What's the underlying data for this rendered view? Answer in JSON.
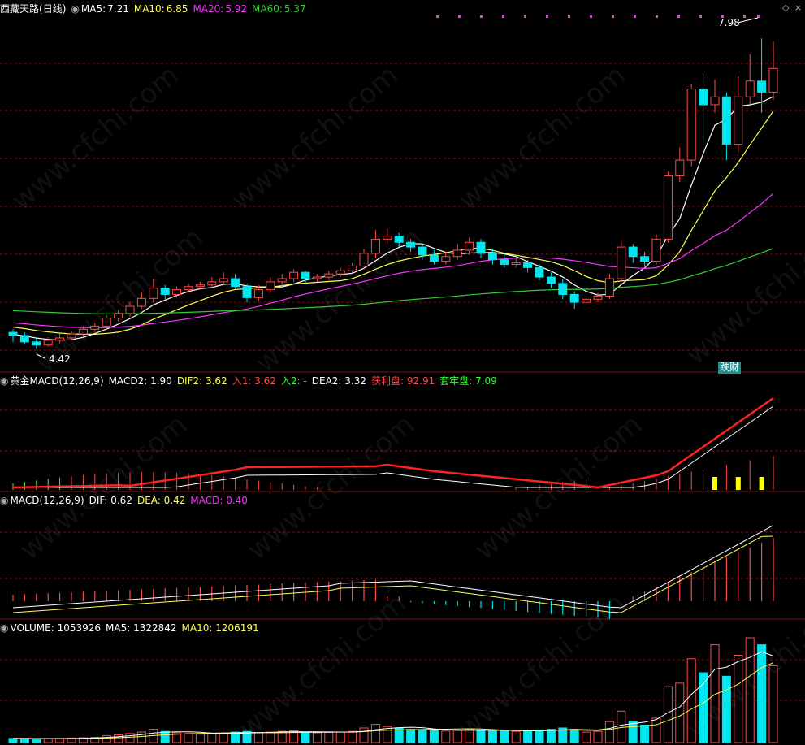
{
  "app": {
    "title": "西藏天路",
    "period": "(日线)"
  },
  "colors": {
    "bg": "#000000",
    "grid": "#7a1212",
    "up": "#ff4a4a",
    "down": "#00e5ee",
    "ma5": "#ffffff",
    "ma10": "#ffff55",
    "ma20": "#ff33ff",
    "ma60": "#33cc33"
  },
  "main": {
    "ma5": {
      "label": "MA5:",
      "value": "7.21"
    },
    "ma10": {
      "label": "MA10:",
      "value": "6.85"
    },
    "ma20": {
      "label": "MA20:",
      "value": "5.92"
    },
    "ma60": {
      "label": "MA60:",
      "value": "5.37"
    },
    "high_label": "7.98",
    "low_label": "4.42",
    "tag": "跌财"
  },
  "gold": {
    "name": "黄金MACD(12,26,9)",
    "macd2": "MACD2: 1.90",
    "dif2": "DIF2: 3.62",
    "in1": "入1: 3.62",
    "in2": "入2: -",
    "dea2": "DEA2: 3.32",
    "profit": "获利盘: 92.91",
    "trapped": "套牢盘: 7.09"
  },
  "macd": {
    "name": "MACD(12,26,9)",
    "dif": "DIF: 0.62",
    "dea": "DEA: 0.42",
    "macd": "MACD: 0.40"
  },
  "volume": {
    "name": "VOLUME: 1053926",
    "ma5": "MA5: 1322842",
    "ma10": "MA10: 1206191"
  },
  "watermark": "www.cfchi.com",
  "chart_data": {
    "type": "candlestick",
    "candles": [
      [
        4.62,
        4.58,
        4.66,
        4.5
      ],
      [
        4.58,
        4.5,
        4.62,
        4.47
      ],
      [
        4.5,
        4.46,
        4.55,
        4.42
      ],
      [
        4.46,
        4.52,
        4.56,
        4.44
      ],
      [
        4.52,
        4.55,
        4.6,
        4.48
      ],
      [
        4.55,
        4.6,
        4.64,
        4.52
      ],
      [
        4.6,
        4.66,
        4.7,
        4.57
      ],
      [
        4.66,
        4.7,
        4.74,
        4.62
      ],
      [
        4.7,
        4.8,
        4.84,
        4.66
      ],
      [
        4.8,
        4.86,
        4.9,
        4.76
      ],
      [
        4.86,
        4.95,
        5.0,
        4.82
      ],
      [
        4.95,
        5.05,
        5.12,
        4.92
      ],
      [
        5.05,
        5.18,
        5.3,
        5.0
      ],
      [
        5.18,
        5.1,
        5.22,
        5.04
      ],
      [
        5.1,
        5.16,
        5.2,
        5.06
      ],
      [
        5.16,
        5.2,
        5.24,
        5.12
      ],
      [
        5.2,
        5.22,
        5.26,
        5.16
      ],
      [
        5.22,
        5.26,
        5.32,
        5.18
      ],
      [
        5.26,
        5.3,
        5.38,
        5.22
      ],
      [
        5.3,
        5.2,
        5.36,
        5.16
      ],
      [
        5.2,
        5.06,
        5.24,
        5.0
      ],
      [
        5.06,
        5.16,
        5.22,
        5.02
      ],
      [
        5.16,
        5.26,
        5.32,
        5.12
      ],
      [
        5.26,
        5.3,
        5.36,
        5.2
      ],
      [
        5.3,
        5.38,
        5.42,
        5.26
      ],
      [
        5.38,
        5.3,
        5.4,
        5.24
      ],
      [
        5.3,
        5.32,
        5.36,
        5.26
      ],
      [
        5.32,
        5.36,
        5.4,
        5.28
      ],
      [
        5.36,
        5.4,
        5.44,
        5.32
      ],
      [
        5.4,
        5.46,
        5.5,
        5.36
      ],
      [
        5.46,
        5.62,
        5.68,
        5.42
      ],
      [
        5.62,
        5.8,
        5.92,
        5.56
      ],
      [
        5.8,
        5.84,
        5.94,
        5.74
      ],
      [
        5.84,
        5.76,
        5.88,
        5.7
      ],
      [
        5.76,
        5.7,
        5.8,
        5.64
      ],
      [
        5.7,
        5.6,
        5.74,
        5.54
      ],
      [
        5.6,
        5.52,
        5.66,
        5.48
      ],
      [
        5.52,
        5.58,
        5.64,
        5.48
      ],
      [
        5.58,
        5.66,
        5.74,
        5.54
      ],
      [
        5.66,
        5.76,
        5.82,
        5.6
      ],
      [
        5.76,
        5.62,
        5.8,
        5.56
      ],
      [
        5.62,
        5.54,
        5.68,
        5.48
      ],
      [
        5.54,
        5.48,
        5.6,
        5.44
      ],
      [
        5.48,
        5.5,
        5.56,
        5.44
      ],
      [
        5.5,
        5.44,
        5.54,
        5.38
      ],
      [
        5.44,
        5.32,
        5.48,
        5.28
      ],
      [
        5.32,
        5.24,
        5.38,
        5.18
      ],
      [
        5.24,
        5.1,
        5.3,
        5.04
      ],
      [
        5.1,
        5.0,
        5.14,
        4.92
      ],
      [
        5.0,
        5.04,
        5.08,
        4.96
      ],
      [
        5.04,
        5.08,
        5.12,
        5.0
      ],
      [
        5.08,
        5.3,
        5.36,
        5.04
      ],
      [
        5.3,
        5.7,
        5.78,
        5.26
      ],
      [
        5.7,
        5.58,
        5.74,
        5.5
      ],
      [
        5.58,
        5.52,
        5.64,
        5.46
      ],
      [
        5.52,
        5.8,
        5.86,
        5.48
      ],
      [
        5.8,
        6.6,
        6.66,
        5.76
      ],
      [
        6.6,
        6.8,
        6.96,
        6.52
      ],
      [
        6.8,
        7.7,
        7.76,
        6.72
      ],
      [
        7.7,
        7.5,
        7.9,
        6.96
      ],
      [
        7.5,
        7.6,
        7.82,
        7.4
      ],
      [
        7.6,
        7.0,
        7.66,
        6.8
      ],
      [
        7.0,
        7.6,
        7.86,
        6.9
      ],
      [
        7.6,
        7.8,
        8.14,
        7.5
      ],
      [
        7.8,
        7.66,
        8.34,
        7.4
      ],
      [
        7.66,
        7.96,
        8.3,
        7.56
      ]
    ],
    "volume": [
      120,
      110,
      100,
      115,
      120,
      130,
      140,
      150,
      200,
      220,
      260,
      300,
      380,
      320,
      280,
      260,
      240,
      250,
      260,
      300,
      320,
      280,
      300,
      320,
      340,
      300,
      280,
      290,
      300,
      320,
      420,
      520,
      460,
      420,
      380,
      360,
      340,
      330,
      350,
      380,
      360,
      340,
      330,
      320,
      340,
      360,
      380,
      420,
      380,
      300,
      320,
      600,
      900,
      600,
      500,
      700,
      1600,
      1700,
      2400,
      2000,
      2800,
      1900,
      2500,
      3000,
      2800,
      2200
    ],
    "ylim": [
      4.2,
      8.6
    ],
    "ma_labels": [
      "MA5",
      "MA10",
      "MA20",
      "MA60"
    ]
  }
}
